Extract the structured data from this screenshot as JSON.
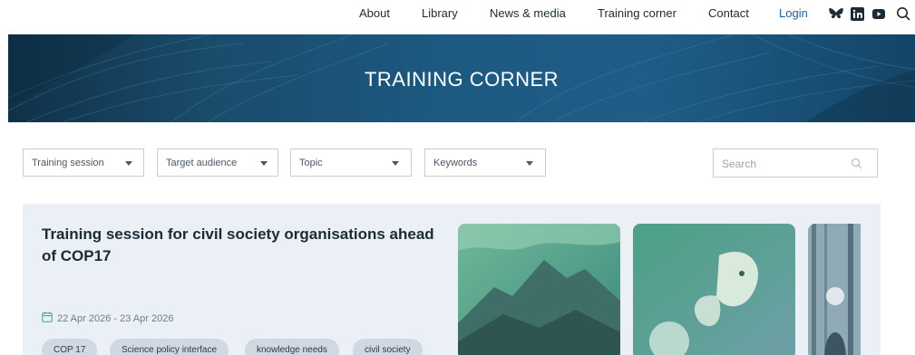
{
  "nav": {
    "items": [
      "About",
      "Library",
      "News & media",
      "Training corner",
      "Contact"
    ],
    "login": "Login",
    "social_icons": [
      "bluesky-icon",
      "linkedin-icon",
      "youtube-icon"
    ],
    "search_icon": "search-icon"
  },
  "hero": {
    "title": "TRAINING CORNER"
  },
  "filters": {
    "training_session": "Training session",
    "target_audience": "Target audience",
    "topic": "Topic",
    "keywords": "Keywords",
    "search_placeholder": "Search"
  },
  "card": {
    "title": "Training session for civil society organisations ahead of COP17",
    "date": "22 Apr 2026 - 23 Apr 2026",
    "tags": [
      "COP 17",
      "Science policy interface",
      "knowledge needs",
      "civil society"
    ]
  },
  "colors": {
    "accent": "#1f5c99",
    "date_icon": "#3aa87a",
    "hero_bg": "#1d5a82"
  }
}
